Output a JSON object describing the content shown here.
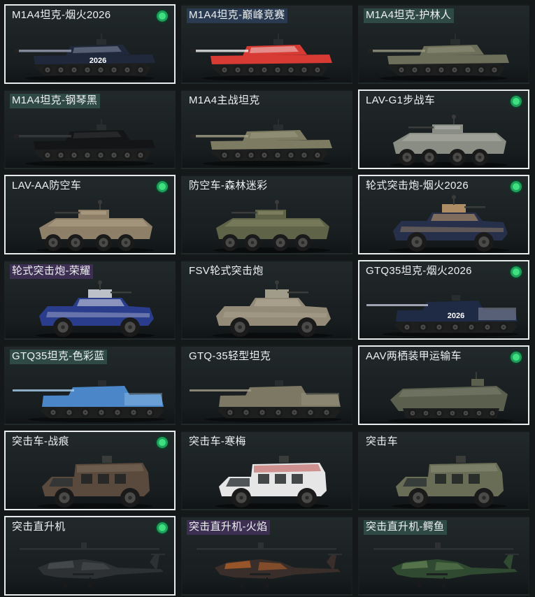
{
  "vehicles": [
    {
      "name": "M1A4坦克-烟火2026",
      "type": "tank",
      "tag": "",
      "selected": true,
      "equipped": true,
      "colors": {
        "body": "#20283c",
        "accent": "#9aa3b8"
      },
      "decal": "2026"
    },
    {
      "name": "M1A4坦克-巅峰竞赛",
      "type": "tank",
      "tag": "blue",
      "selected": false,
      "equipped": false,
      "colors": {
        "body": "#d83a34",
        "accent": "#f1f1f1"
      },
      "decal": ""
    },
    {
      "name": "M1A4坦克-护林人",
      "type": "tank",
      "tag": "teal",
      "selected": false,
      "equipped": false,
      "colors": {
        "body": "#6d6f5a",
        "accent": "#9a9a82"
      },
      "decal": ""
    },
    {
      "name": "M1A4坦克-钢琴黑",
      "type": "tank",
      "tag": "teal",
      "selected": false,
      "equipped": false,
      "colors": {
        "body": "#141516",
        "accent": "#3a3d40"
      },
      "decal": ""
    },
    {
      "name": "M1A4主战坦克",
      "type": "tank",
      "tag": "",
      "selected": false,
      "equipped": false,
      "colors": {
        "body": "#7d7c62",
        "accent": "#a3a088"
      },
      "decal": ""
    },
    {
      "name": "LAV-G1步战车",
      "type": "apc8",
      "tag": "",
      "selected": true,
      "equipped": true,
      "colors": {
        "body": "#8a8d84",
        "accent": "#b3b6ad"
      },
      "decal": ""
    },
    {
      "name": "LAV-AA防空车",
      "type": "apc8",
      "tag": "",
      "selected": true,
      "equipped": true,
      "colors": {
        "body": "#8e8068",
        "accent": "#b5a78c"
      },
      "decal": ""
    },
    {
      "name": "防空车-森林迷彩",
      "type": "apc8",
      "tag": "",
      "selected": false,
      "equipped": false,
      "colors": {
        "body": "#5f6449",
        "accent": "#8e8e6a"
      },
      "decal": ""
    },
    {
      "name": "轮式突击炮-烟火2026",
      "type": "apc4",
      "tag": "",
      "selected": true,
      "equipped": true,
      "colors": {
        "body": "#26304a",
        "accent": "#c9a070"
      },
      "decal": ""
    },
    {
      "name": "轮式突击炮-荣耀",
      "type": "apc4",
      "tag": "purple",
      "selected": false,
      "equipped": false,
      "colors": {
        "body": "#2a3d8c",
        "accent": "#d8dce6"
      },
      "decal": ""
    },
    {
      "name": "FSV轮式突击炮",
      "type": "apc4",
      "tag": "",
      "selected": false,
      "equipped": false,
      "colors": {
        "body": "#938b78",
        "accent": "#b8b09c"
      },
      "decal": ""
    },
    {
      "name": "GTQ35坦克-烟火2026",
      "type": "light",
      "tag": "",
      "selected": true,
      "equipped": true,
      "colors": {
        "body": "#1f2a44",
        "accent": "#c0c6d6"
      },
      "decal": "2026"
    },
    {
      "name": "GTQ35坦克-色彩蓝",
      "type": "light",
      "tag": "teal",
      "selected": false,
      "equipped": false,
      "colors": {
        "body": "#4a86c8",
        "accent": "#a9d0f0"
      },
      "decal": ""
    },
    {
      "name": "GTQ-35轻型坦克",
      "type": "light",
      "tag": "",
      "selected": false,
      "equipped": false,
      "colors": {
        "body": "#7c7864",
        "accent": "#a39e88"
      },
      "decal": ""
    },
    {
      "name": "AAV两栖装甲运输车",
      "type": "aav",
      "tag": "",
      "selected": true,
      "equipped": true,
      "colors": {
        "body": "#5a5f4e",
        "accent": "#7e8270"
      },
      "decal": ""
    },
    {
      "name": "突击车-战痕",
      "type": "mrap",
      "tag": "",
      "selected": true,
      "equipped": true,
      "colors": {
        "body": "#5a4a3e",
        "accent": "#7d6d5e"
      },
      "decal": ""
    },
    {
      "name": "突击车-寒梅",
      "type": "mrap",
      "tag": "",
      "selected": false,
      "equipped": false,
      "colors": {
        "body": "#e6e6e6",
        "accent": "#b83a3a"
      },
      "decal": ""
    },
    {
      "name": "突击车",
      "type": "mrap",
      "tag": "",
      "selected": false,
      "equipped": false,
      "colors": {
        "body": "#6a6d56",
        "accent": "#8e917a"
      },
      "decal": ""
    },
    {
      "name": "突击直升机",
      "type": "heli",
      "tag": "",
      "selected": true,
      "equipped": true,
      "colors": {
        "body": "#2e3133",
        "accent": "#55595c"
      },
      "decal": ""
    },
    {
      "name": "突击直升机-火焰",
      "type": "heli",
      "tag": "purple",
      "selected": false,
      "equipped": false,
      "colors": {
        "body": "#3a2e2a",
        "accent": "#d6702a"
      },
      "decal": ""
    },
    {
      "name": "突击直升机-鳄鱼",
      "type": "heli",
      "tag": "teal",
      "selected": false,
      "equipped": false,
      "colors": {
        "body": "#2f4a30",
        "accent": "#6e8f5e"
      },
      "decal": ""
    }
  ],
  "colors": {
    "background": "#141819",
    "card": "#1c2224",
    "selected_border": "#e9ecec",
    "equipped_dot": "#3ee07f"
  }
}
